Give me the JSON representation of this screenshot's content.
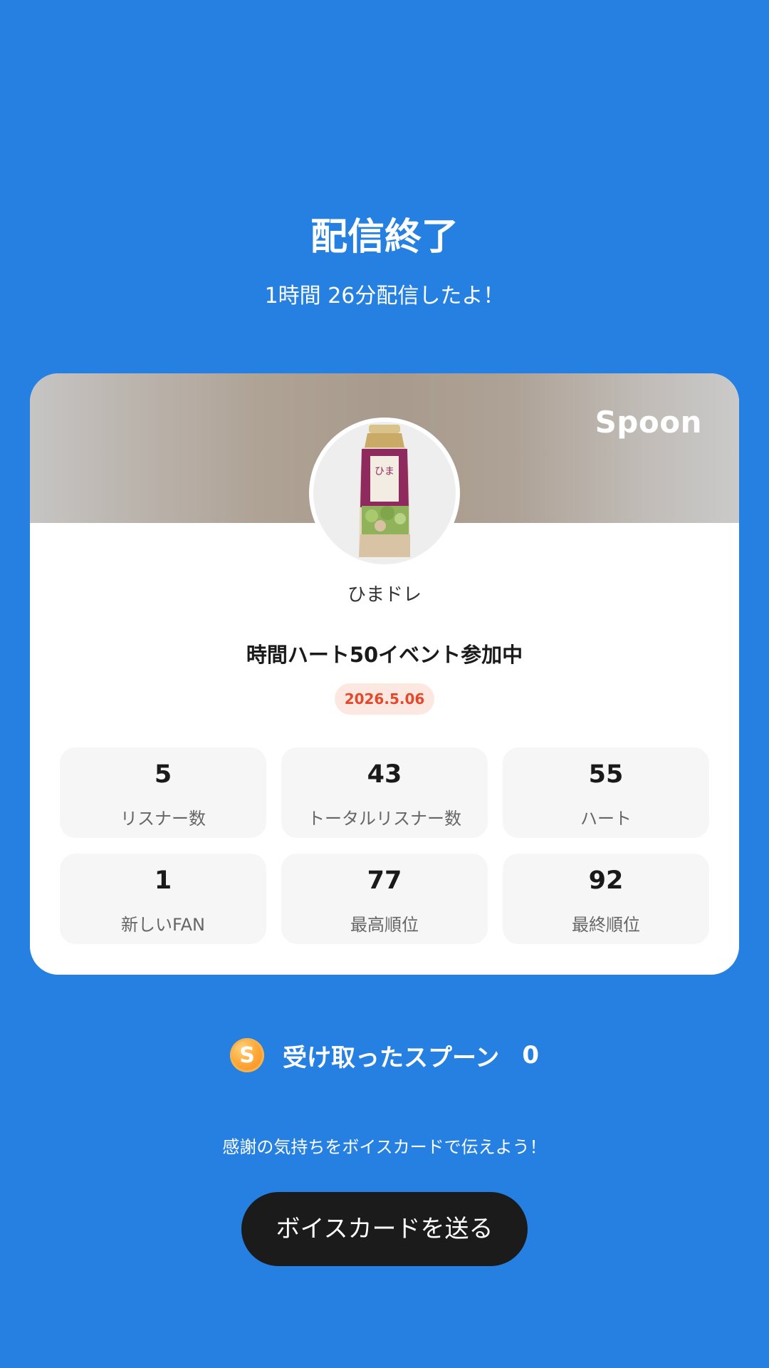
{
  "header": {
    "title": "配信終了",
    "subtitle": "1時間 26分配信したよ！"
  },
  "card": {
    "brand": "Spoon",
    "avatar_icon": "dressing-bottle-avatar",
    "username": "ひまドレ",
    "event_title": "時間ハート50イベント参加中",
    "date": "2026.5.06",
    "stats": [
      {
        "value": "5",
        "label": "リスナー数"
      },
      {
        "value": "43",
        "label": "トータルリスナー数"
      },
      {
        "value": "55",
        "label": "ハート"
      },
      {
        "value": "1",
        "label": "新しいFAN"
      },
      {
        "value": "77",
        "label": "最高順位"
      },
      {
        "value": "92",
        "label": "最終順位"
      }
    ]
  },
  "spoons": {
    "icon": "spoon-coin-icon",
    "icon_letter": "S",
    "label": "受け取ったスプーン",
    "count": "0"
  },
  "voice_card": {
    "prompt": "感謝の気持ちをボイスカードで伝えよう！",
    "button_label": "ボイスカードを送る"
  },
  "colors": {
    "background": "#2580e2",
    "date_badge_text": "#e5492c",
    "date_badge_bg": "#fde7e1",
    "button_bg": "#1b1b1b"
  }
}
